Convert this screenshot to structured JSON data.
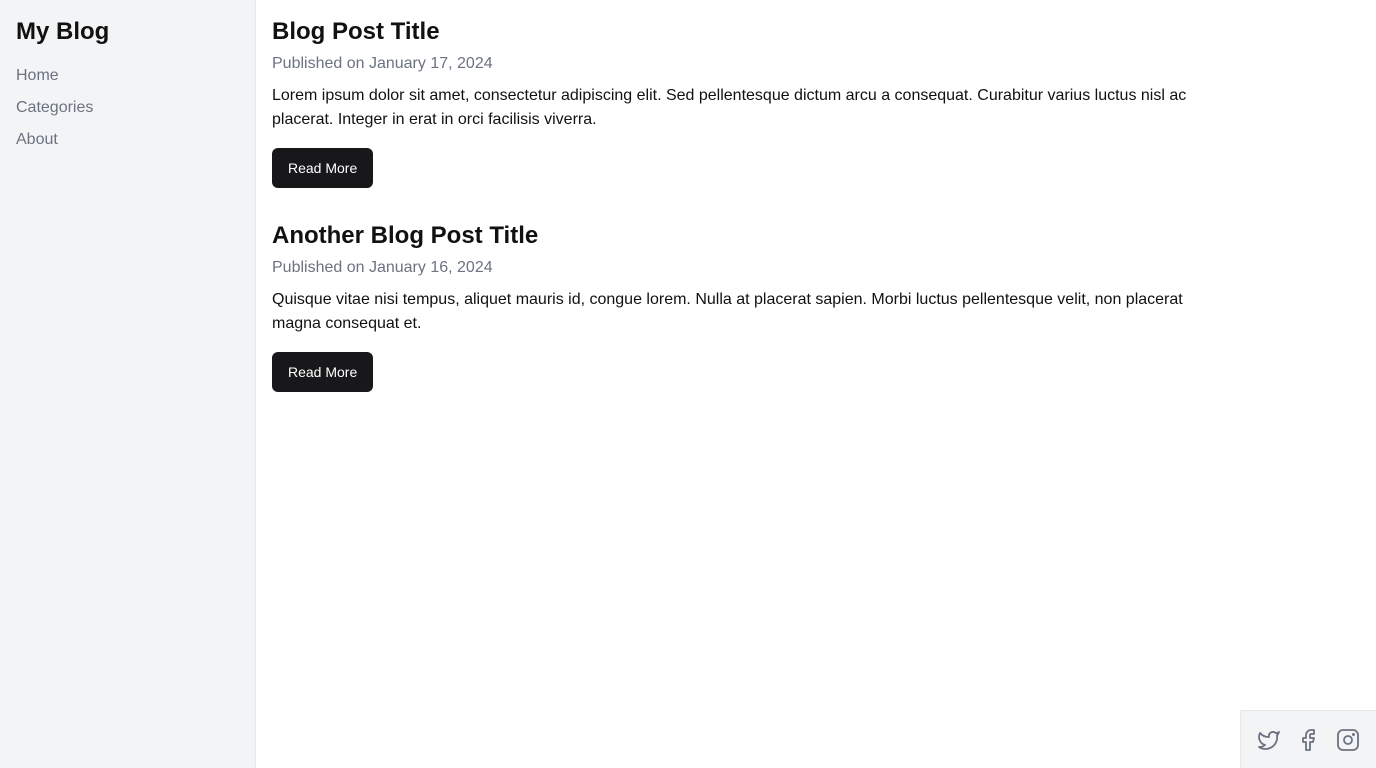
{
  "sidebar": {
    "brand": "My Blog",
    "items": [
      {
        "label": "Home"
      },
      {
        "label": "Categories"
      },
      {
        "label": "About"
      }
    ]
  },
  "posts": [
    {
      "title": "Blog Post Title",
      "date": "Published on January 17, 2024",
      "body": "Lorem ipsum dolor sit amet, consectetur adipiscing elit. Sed pellentesque dictum arcu a consequat. Curabitur varius luctus nisl ac placerat. Integer in erat in orci facilisis viverra.",
      "button_label": "Read More"
    },
    {
      "title": "Another Blog Post Title",
      "date": "Published on January 16, 2024",
      "body": "Quisque vitae nisi tempus, aliquet mauris id, congue lorem. Nulla at placerat sapien. Morbi luctus pellentesque velit, non placerat magna consequat et.",
      "button_label": "Read More"
    }
  ],
  "social": {
    "icons": [
      "twitter-icon",
      "facebook-icon",
      "instagram-icon"
    ],
    "icon_color": "#6b7280"
  },
  "colors": {
    "sidebar_bg": "#f3f4f6",
    "button_bg": "#18181b",
    "muted_text": "#6b7280"
  }
}
